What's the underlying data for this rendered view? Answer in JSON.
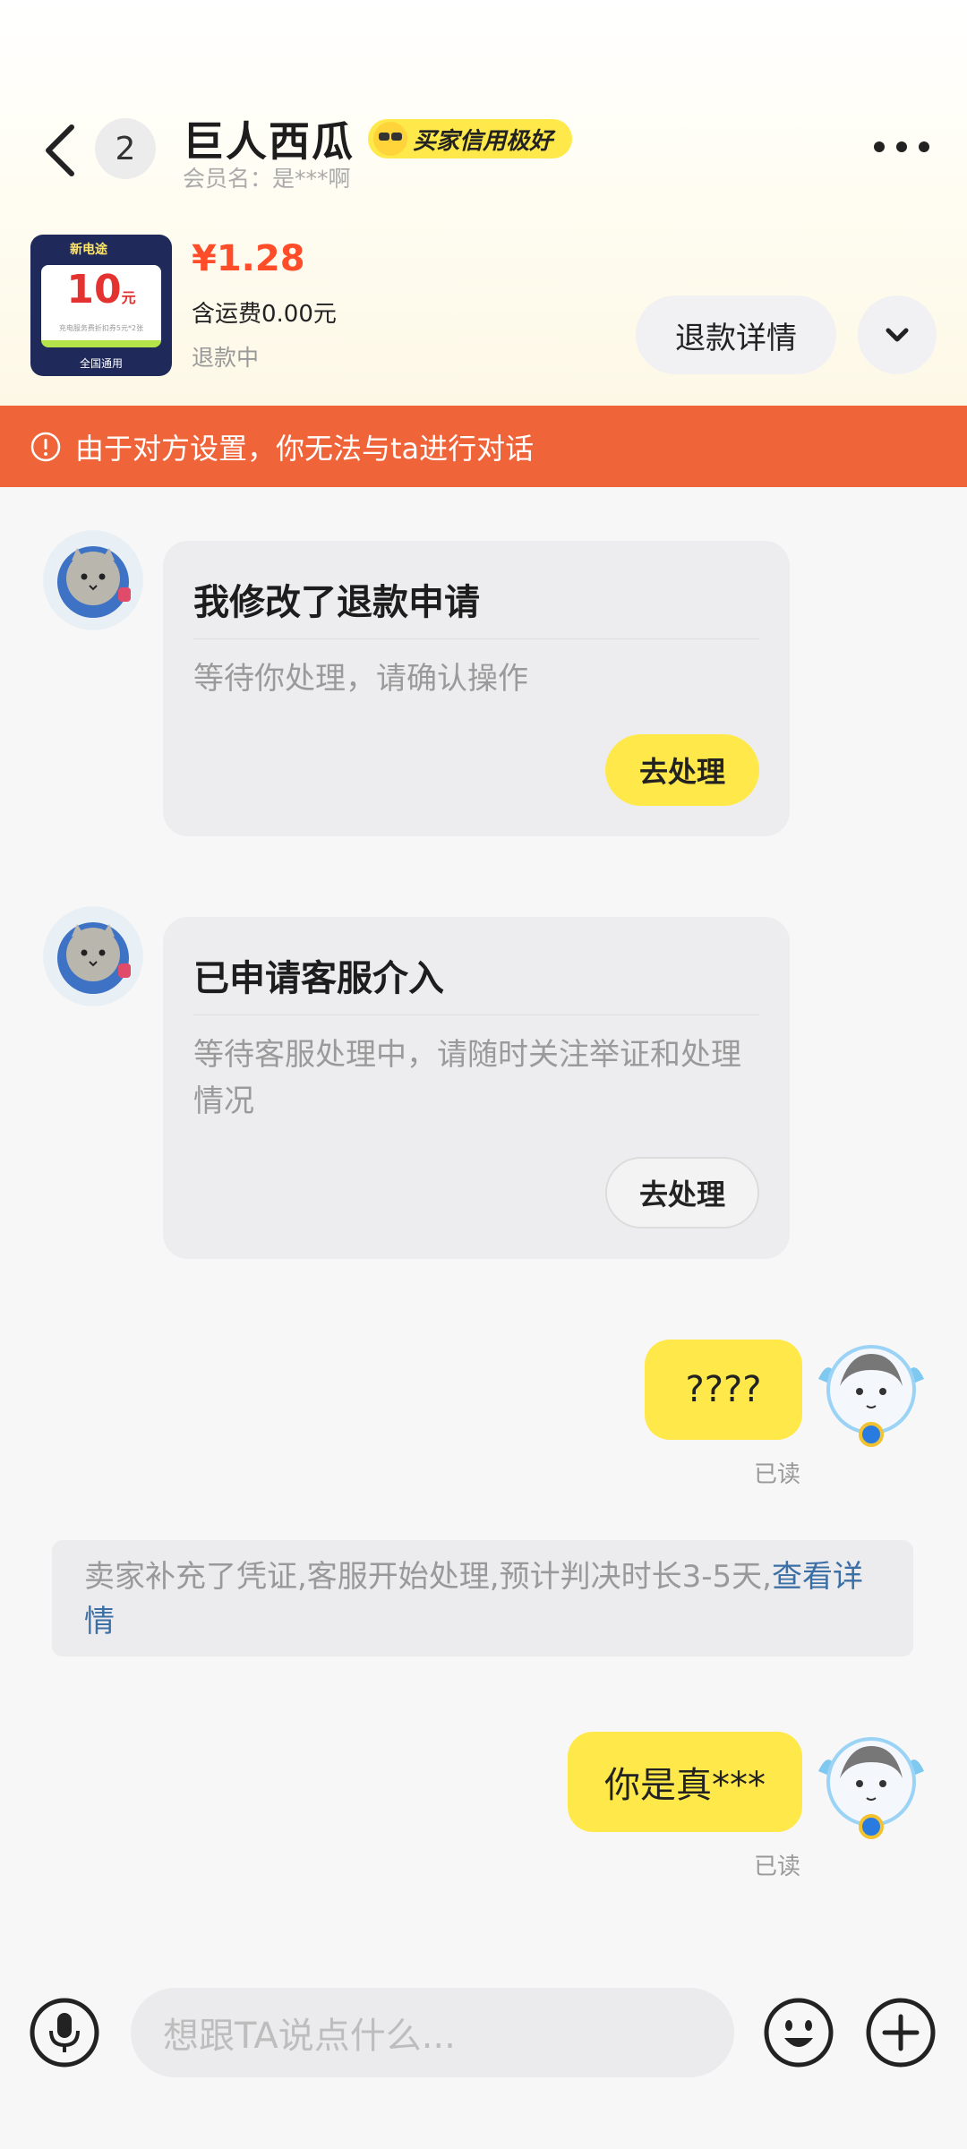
{
  "header": {
    "unread_count": "2",
    "shop_name": "巨人西瓜",
    "credit_badge": "买家信用极好",
    "member_name": "会员名：是***啊"
  },
  "product": {
    "thumb_brand": "新电途",
    "thumb_amount": "10",
    "thumb_unit": "元",
    "thumb_sub": "充电服务费折扣券5元*2张",
    "thumb_bottom": "全国通用",
    "price": "¥1.28",
    "shipping": "含运费0.00元",
    "status": "退款中",
    "refund_button": "退款详情"
  },
  "warning": "由于对方设置，你无法与ta进行对话",
  "messages": {
    "card1": {
      "title": "我修改了退款申请",
      "desc": "等待你处理，请确认操作",
      "button": "去处理"
    },
    "card2": {
      "title": "已申请客服介入",
      "desc": "等待客服处理中，请随时关注举证和处理情况",
      "button": "去处理"
    },
    "me1": {
      "text": "????",
      "read": "已读"
    },
    "system": {
      "text": "卖家补充了凭证,客服开始处理,预计判决时长3-5天,",
      "link": "查看详情"
    },
    "me2": {
      "text": "你是真***",
      "read": "已读"
    }
  },
  "input": {
    "placeholder": "想跟TA说点什么..."
  },
  "colors": {
    "warning_bg": "#f0643a",
    "accent_yellow": "#ffe94a",
    "price": "#ff4d2a",
    "link": "#3c6fa6"
  }
}
